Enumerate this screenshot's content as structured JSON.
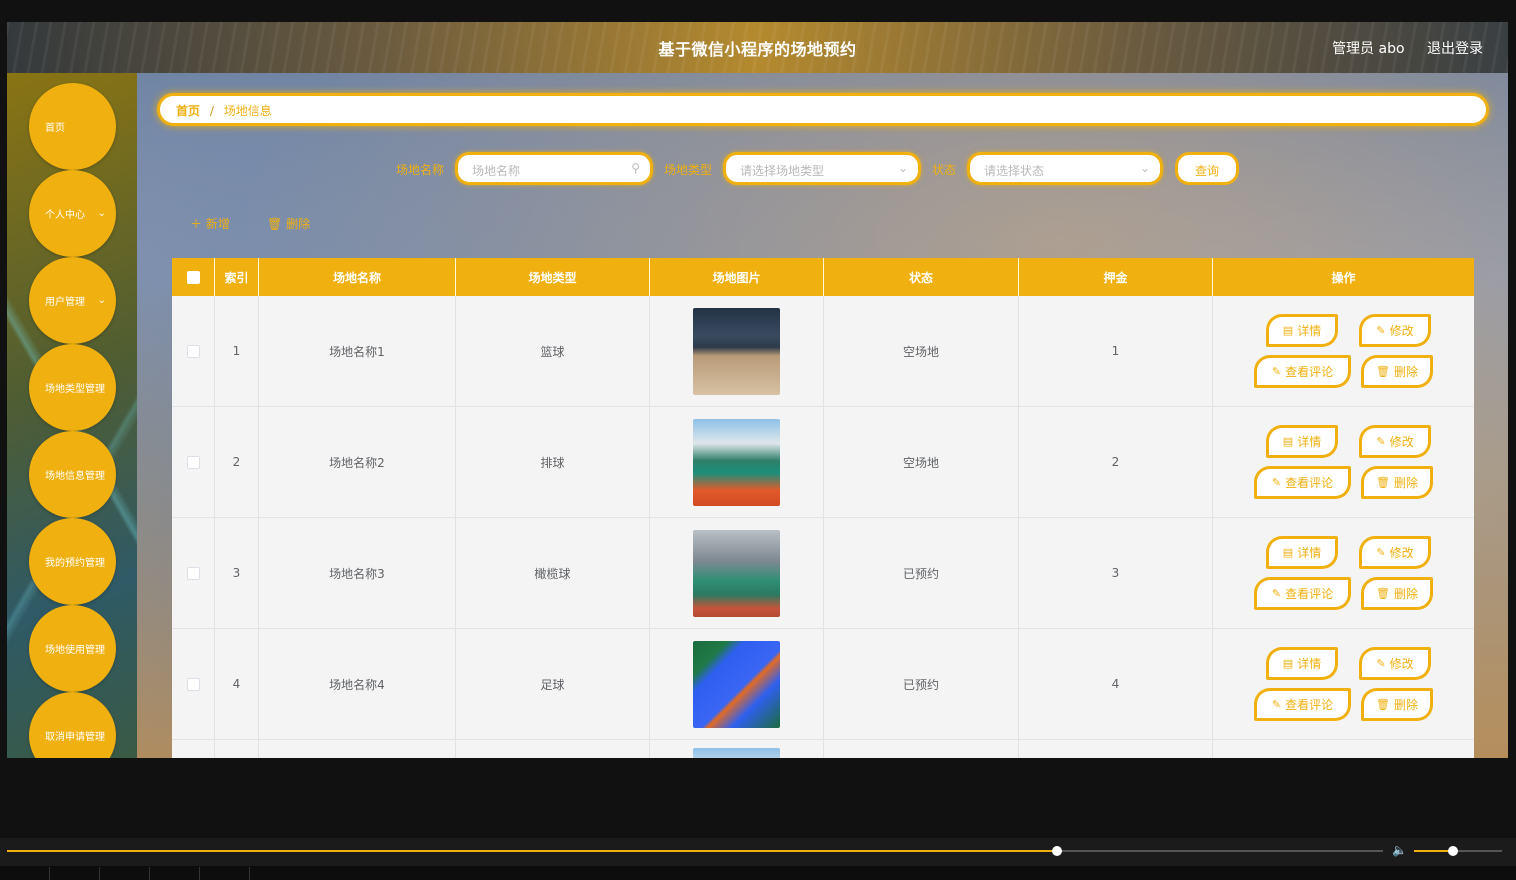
{
  "app": {
    "title": "基于微信小程序的场地预约",
    "user_label": "管理员 abo",
    "logout_label": "退出登录"
  },
  "sidebar": {
    "items": [
      {
        "label": "首页",
        "has_children": false
      },
      {
        "label": "个人中心",
        "has_children": true
      },
      {
        "label": "用户管理",
        "has_children": true
      },
      {
        "label": "场地类型管理",
        "has_children": false
      },
      {
        "label": "场地信息管理",
        "has_children": false
      },
      {
        "label": "我的预约管理",
        "has_children": false
      },
      {
        "label": "场地使用管理",
        "has_children": false
      },
      {
        "label": "取消申请管理",
        "has_children": false
      }
    ]
  },
  "breadcrumb": {
    "home": "首页",
    "separator": "/",
    "current": "场地信息"
  },
  "filters": {
    "name_label": "场地名称",
    "name_placeholder": "场地名称",
    "type_label": "场地类型",
    "type_placeholder": "请选择场地类型",
    "status_label": "状态",
    "status_placeholder": "请选择状态",
    "query_label": "查询"
  },
  "actions": {
    "add_label": "新增",
    "delete_label": "删除"
  },
  "table": {
    "columns": [
      "索引",
      "场地名称",
      "场地类型",
      "场地图片",
      "状态",
      "押金",
      "操作"
    ],
    "op_labels": {
      "detail": "详情",
      "edit": "修改",
      "comment": "查看评论",
      "delete": "删除"
    },
    "rows": [
      {
        "index": "1",
        "name": "场地名称1",
        "type": "篮球",
        "status": "空场地",
        "deposit": "1"
      },
      {
        "index": "2",
        "name": "场地名称2",
        "type": "排球",
        "status": "空场地",
        "deposit": "2"
      },
      {
        "index": "3",
        "name": "场地名称3",
        "type": "橄榄球",
        "status": "已预约",
        "deposit": "3"
      },
      {
        "index": "4",
        "name": "场地名称4",
        "type": "足球",
        "status": "已预约",
        "deposit": "4"
      }
    ]
  },
  "colors": {
    "accent": "#f0b010",
    "text": "#606266",
    "row_bg": "#f4f4f4"
  },
  "player": {
    "progress": 0.763,
    "volume": 0.44
  }
}
